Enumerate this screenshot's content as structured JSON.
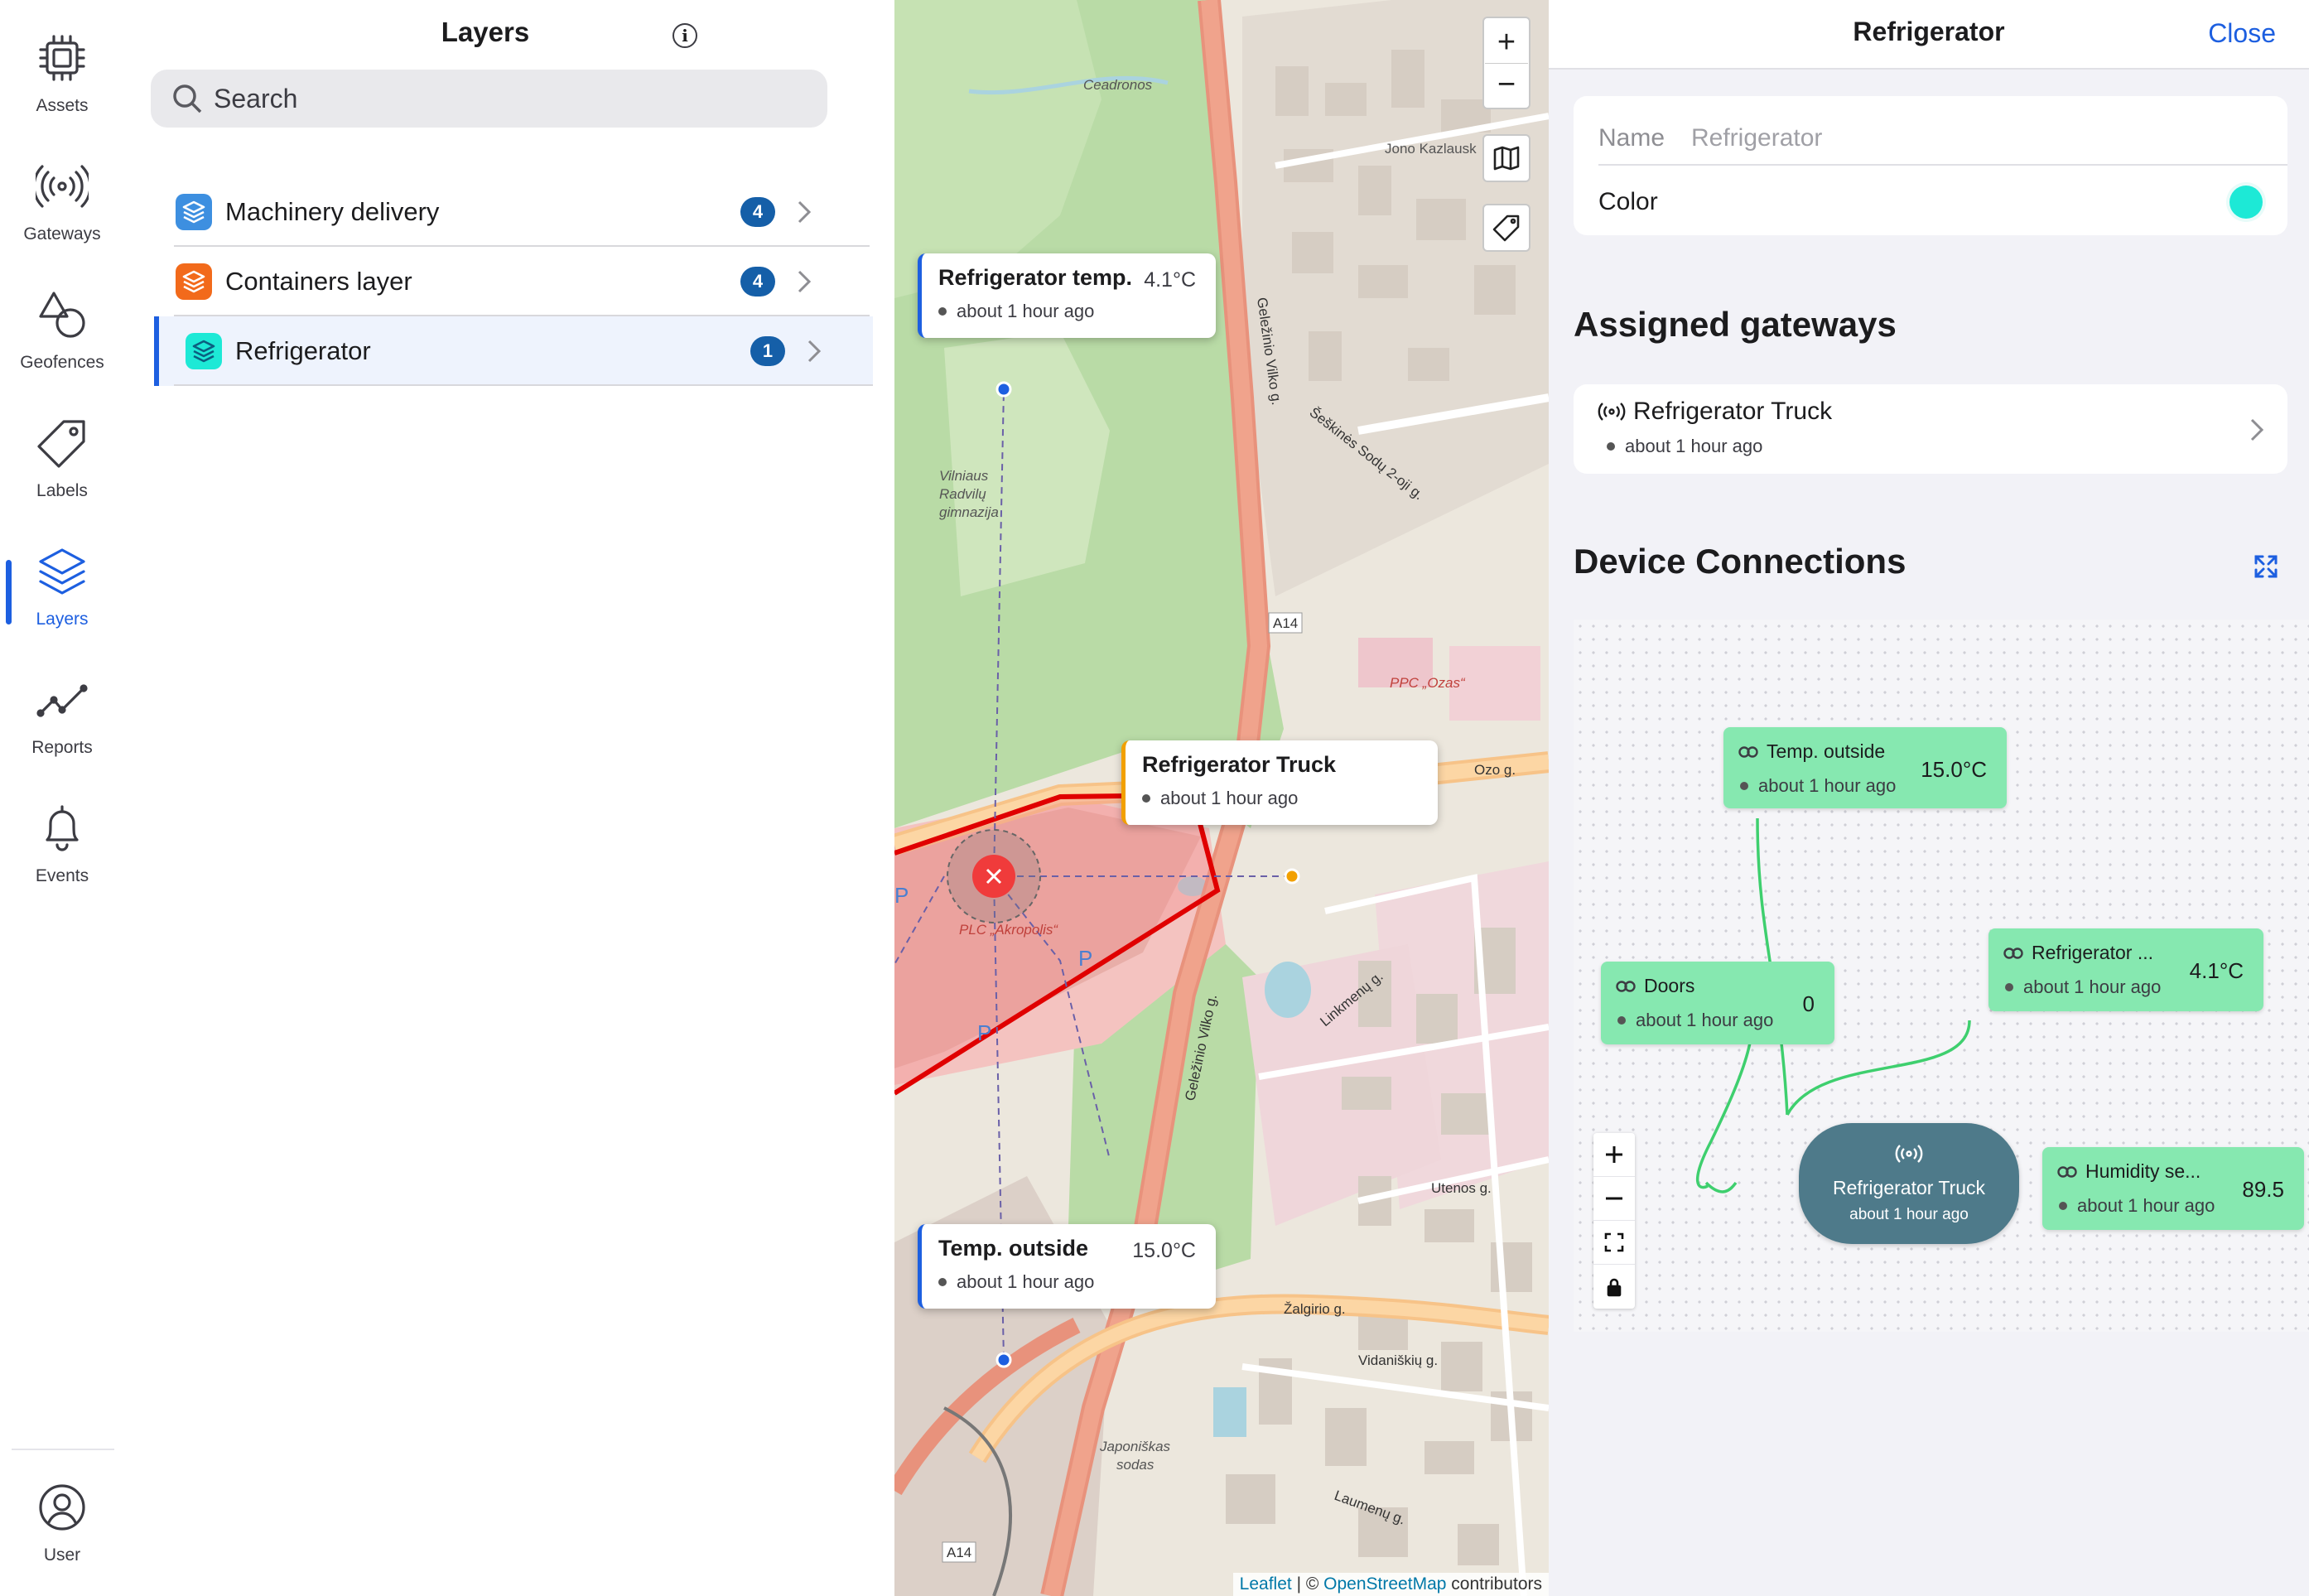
{
  "nav": {
    "items": [
      {
        "label": "Assets",
        "icon": "chip-icon"
      },
      {
        "label": "Gateways",
        "icon": "broadcast-icon"
      },
      {
        "label": "Geofences",
        "icon": "shapes-icon"
      },
      {
        "label": "Labels",
        "icon": "tag-icon"
      },
      {
        "label": "Layers",
        "icon": "layers-icon",
        "active": true
      },
      {
        "label": "Reports",
        "icon": "line-chart-icon"
      },
      {
        "label": "Events",
        "icon": "bell-icon"
      }
    ],
    "user_label": "User"
  },
  "layers_panel": {
    "title": "Layers",
    "search_placeholder": "Search",
    "items": [
      {
        "name": "Machinery delivery",
        "count": "4",
        "color": "#3d8fe0"
      },
      {
        "name": "Containers layer",
        "count": "4",
        "color": "#f26a1b"
      },
      {
        "name": "Refrigerator",
        "count": "1",
        "color": "#1de9d6",
        "selected": true
      }
    ]
  },
  "map": {
    "zoom_in": "+",
    "zoom_out": "−",
    "popups": [
      {
        "title": "Refrigerator temp.",
        "value": "4.1°C",
        "time": "about 1 hour ago"
      },
      {
        "title": "Refrigerator Truck",
        "value": "",
        "time": "about 1 hour ago"
      },
      {
        "title": "Temp. outside",
        "value": "15.0°C",
        "time": "about 1 hour ago"
      }
    ],
    "place_labels": [
      "Ceadronos",
      "Jono Kazlausk",
      "Geležinio Vilko g.",
      "Šeškinės Sodų 2-oji g.",
      "Vilniaus Radvilų gimnazija",
      "A14",
      "PPC \"Ozas\"",
      "Ozo g.",
      "PLC \"Akropolis\"",
      "Linkmenų g.",
      "Žalgirio g.",
      "Japoniškas sodas",
      "Vidaniškių g.",
      "Utenos g.",
      "Laumenų g."
    ],
    "attribution": {
      "leaflet": "Leaflet",
      "sep": " | © ",
      "osm": "OpenStreetMap",
      "suffix": " contributors"
    }
  },
  "detail": {
    "title": "Refrigerator",
    "close_label": "Close",
    "name_label": "Name",
    "name_placeholder": "Refrigerator",
    "color_label": "Color",
    "color_value": "#1de9d6",
    "assigned_heading": "Assigned gateways",
    "gateway": {
      "name": "Refrigerator Truck",
      "time": "about 1 hour ago"
    },
    "connections_heading": "Device Connections",
    "nodes": [
      {
        "name": "Temp. outside",
        "value": "15.0°C",
        "time": "about 1 hour ago"
      },
      {
        "name": "Refrigerator ...",
        "value": "4.1°C",
        "time": "about 1 hour ago"
      },
      {
        "name": "Doors",
        "value": "0",
        "time": "about 1 hour ago"
      },
      {
        "name": "Humidity se...",
        "value": "89.5",
        "time": "about 1 hour ago"
      }
    ],
    "hub": {
      "name": "Refrigerator Truck",
      "time": "about 1 hour ago"
    }
  }
}
